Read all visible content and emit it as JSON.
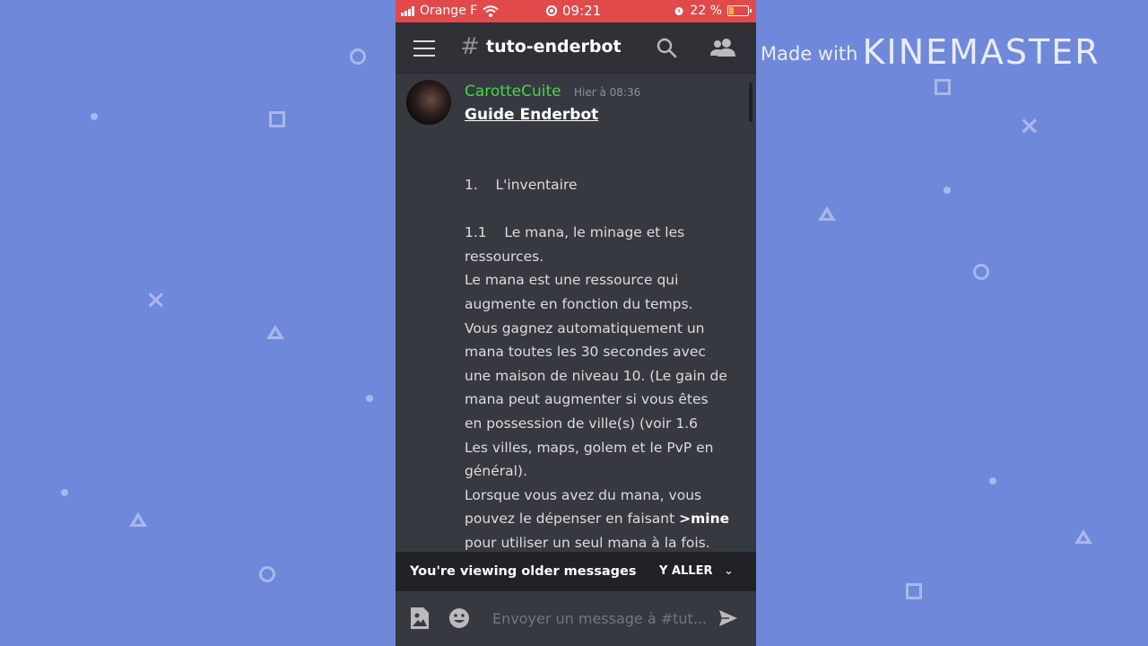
{
  "watermark": {
    "made_with": "Made with",
    "brand": "KINEMASTER"
  },
  "statusbar": {
    "carrier": "Orange F",
    "time": "09:21",
    "battery": "22 %"
  },
  "appbar": {
    "hash": "#",
    "channel": "tuto-enderbot"
  },
  "message": {
    "author": "CarotteCuite",
    "author_color": "#43d847",
    "time": "Hier à 08:36",
    "title": "Guide Enderbot",
    "lines": {
      "l1": "1.    L'inventaire",
      "l2": "1.1    Le mana, le minage et les",
      "l3": "ressources.",
      "l4": "Le mana est une ressource qui",
      "l5": "augmente en fonction du temps.",
      "l6": "Vous gagnez automatiquement un",
      "l7": "mana toutes les 30 secondes avec",
      "l8": "une maison de niveau 10. (Le gain de",
      "l9": "mana peut augmenter si vous êtes",
      "l10": "en possession de ville(s) (voir 1.6",
      "l11": "Les villes, maps, golem et le PvP en",
      "l12": "général).",
      "l13": "Lorsque vous avez du mana, vous",
      "l14a": "pouvez le dépenser en faisant ",
      "l14b": ">mine",
      "l15": "pour utiliser un seul mana à la fois."
    }
  },
  "older_bar": {
    "text": "You're viewing older messages",
    "jump": "Y ALLER",
    "chevron": "⌄"
  },
  "composer": {
    "placeholder": "Envoyer un message à #tut..."
  },
  "colors": {
    "background": "#6f88d9",
    "statusbar": "#e04a4a",
    "chat": "#36393f",
    "header": "#2f3136"
  }
}
